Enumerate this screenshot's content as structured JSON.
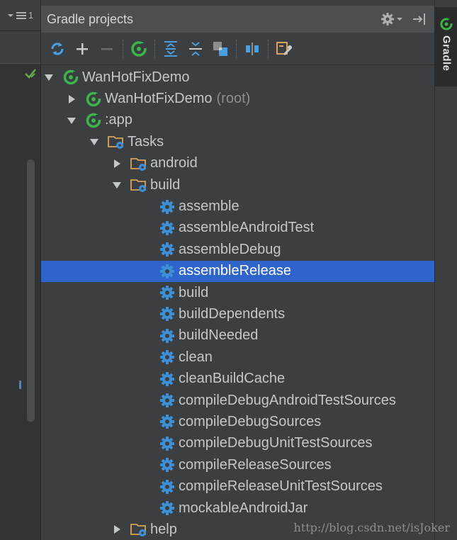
{
  "gutter": {
    "top_label": "1"
  },
  "panel": {
    "title": "Gradle projects",
    "toolbar": [
      {
        "name": "refresh-icon"
      },
      {
        "name": "add-icon"
      },
      {
        "name": "remove-icon"
      },
      {
        "name": "gradle-execute-icon"
      },
      {
        "name": "expand-all-icon"
      },
      {
        "name": "collapse-all-icon"
      },
      {
        "name": "group-modules-icon"
      },
      {
        "name": "offline-mode-icon"
      },
      {
        "name": "settings-icon"
      }
    ]
  },
  "tree": {
    "root": "WanHotFixDemo",
    "root_child": "WanHotFixDemo",
    "root_child_suffix": "(root)",
    "app": ":app",
    "tasks": "Tasks",
    "android": "android",
    "build": "build",
    "build_tasks": [
      "assemble",
      "assembleAndroidTest",
      "assembleDebug",
      "assembleRelease",
      "build",
      "buildDependents",
      "buildNeeded",
      "clean",
      "cleanBuildCache",
      "compileDebugAndroidTestSources",
      "compileDebugSources",
      "compileDebugUnitTestSources",
      "compileReleaseSources",
      "compileReleaseUnitTestSources",
      "mockableAndroidJar"
    ],
    "selected_task": "assembleRelease",
    "help": "help"
  },
  "strip": {
    "label": "Gradle"
  },
  "watermark": "http://blog.csdn.net/isJoker",
  "colors": {
    "selection": "#2f65ca",
    "gradle_green": "#3eb54a",
    "folder": "#d9a35b",
    "gear": "#3d8fd6"
  }
}
